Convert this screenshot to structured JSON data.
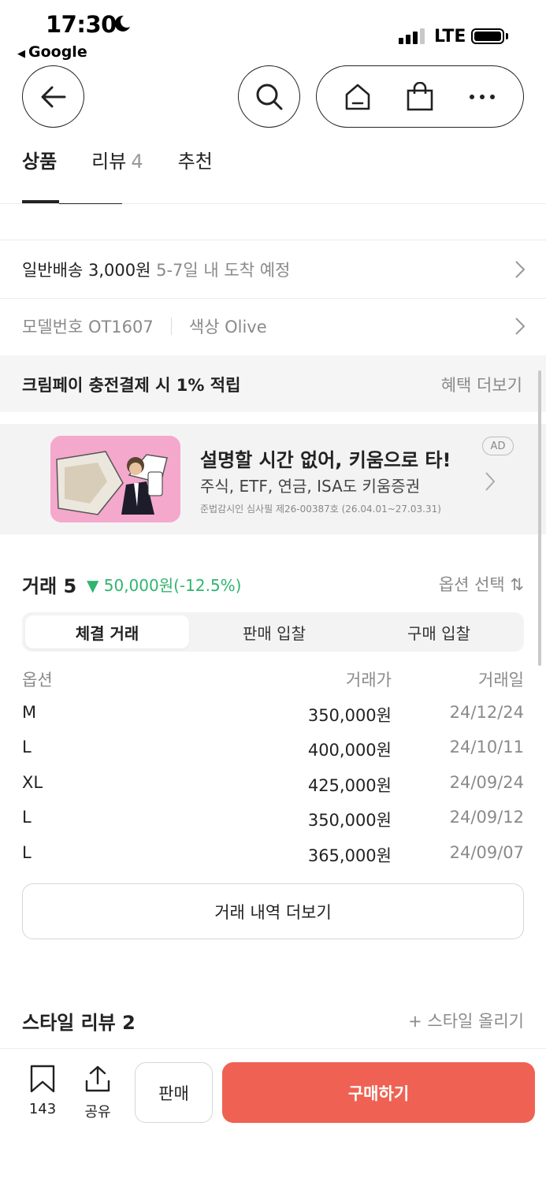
{
  "status_bar": {
    "time": "17:30",
    "back_app": "Google",
    "network": "LTE"
  },
  "nav": {
    "icons": [
      "back-arrow-icon",
      "search-icon",
      "home-icon",
      "shopping-bag-icon",
      "more-icon"
    ]
  },
  "tabs": [
    {
      "label": "상품",
      "count": ""
    },
    {
      "label": "리뷰",
      "count": "4"
    },
    {
      "label": "추천",
      "count": ""
    }
  ],
  "shipping": {
    "label": "일반배송 3,000원",
    "eta": "5-7일 내 도착 예정"
  },
  "model": {
    "model_no": "모델번호 OT1607",
    "color": "색상 Olive"
  },
  "benefit": {
    "text": "크림페이 충전결제 시 1% 적립",
    "link": "혜택 더보기"
  },
  "ad": {
    "title": "설명할 시간 없어, 키움으로 타!",
    "subtitle": "주식, ETF, 연금, ISA도 키움증권",
    "legal": "준법감시인 심사필 제26-00387호 (26.04.01~27.03.31)",
    "badge": "AD"
  },
  "trades": {
    "title": "거래 5",
    "delta": "▼ 50,000원(-12.5%)",
    "option_select": "옵션 선택 ⇅",
    "accent_color": "#31b46e",
    "segments": [
      "체결 거래",
      "판매 입찰",
      "구매 입찰"
    ],
    "columns": [
      "옵션",
      "거래가",
      "거래일"
    ],
    "rows": [
      {
        "option": "M",
        "price": "350,000원",
        "date": "24/12/24"
      },
      {
        "option": "L",
        "price": "400,000원",
        "date": "24/10/11"
      },
      {
        "option": "XL",
        "price": "425,000원",
        "date": "24/09/24"
      },
      {
        "option": "L",
        "price": "350,000원",
        "date": "24/09/12"
      },
      {
        "option": "L",
        "price": "365,000원",
        "date": "24/09/07"
      }
    ],
    "more": "거래 내역 더보기"
  },
  "style_review": {
    "title": "스타일 리뷰 2",
    "upload": "+ 스타일 올리기"
  },
  "bottom": {
    "bookmark_count": "143",
    "share_label": "공유",
    "sell": "판매",
    "buy": "구매하기",
    "buy_color": "#ef6253"
  }
}
